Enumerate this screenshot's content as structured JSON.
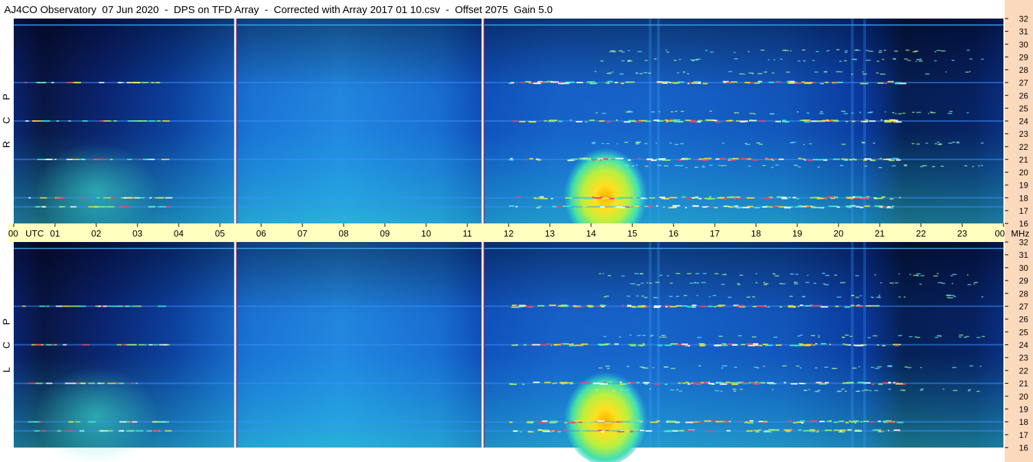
{
  "title": "AJ4CO Observatory  07 Jun 2020  -  DPS on TFD Array  -  Corrected with Array 2017 01 10.csv  -  Offset 2075  Gain 5.0",
  "colors": {
    "background": "#ffffff",
    "time_axis_band": "#ffffc0",
    "freq_axis_band": "#fbd9bd",
    "low": "#000010",
    "mid": "#1e78e6",
    "high": "#ffe619",
    "peak": "#ff3246"
  },
  "chart_data": {
    "type": "heatmap",
    "panels": [
      {
        "label": "R C P",
        "label_letters": [
          "R",
          "C",
          "P"
        ]
      },
      {
        "label": "L C P",
        "label_letters": [
          "L",
          "C",
          "P"
        ]
      }
    ],
    "x_axis": {
      "unit": "UTC",
      "range_hours": [
        0,
        24
      ],
      "tick_labels": [
        "00",
        "01",
        "02",
        "03",
        "04",
        "05",
        "06",
        "07",
        "08",
        "09",
        "10",
        "11",
        "12",
        "13",
        "14",
        "15",
        "16",
        "17",
        "18",
        "19",
        "20",
        "21",
        "22",
        "23",
        "00"
      ]
    },
    "y_axis": {
      "unit": "MHz",
      "range_mhz": [
        16,
        32
      ],
      "tick_labels": [
        "32",
        "31",
        "30",
        "29",
        "28",
        "27",
        "26",
        "25",
        "24",
        "23",
        "22",
        "21",
        "20",
        "19",
        "18",
        "17",
        "16"
      ]
    },
    "vertical_lines_utc": [
      5.37,
      11.37
    ],
    "bright_interference_bands_mhz": [
      27,
      24,
      21,
      18,
      17.3
    ],
    "radio_burst": {
      "time_utc": [
        13.5,
        15.2
      ],
      "freq_mhz": [
        16,
        22
      ],
      "peak_time_utc": 14.6
    }
  }
}
